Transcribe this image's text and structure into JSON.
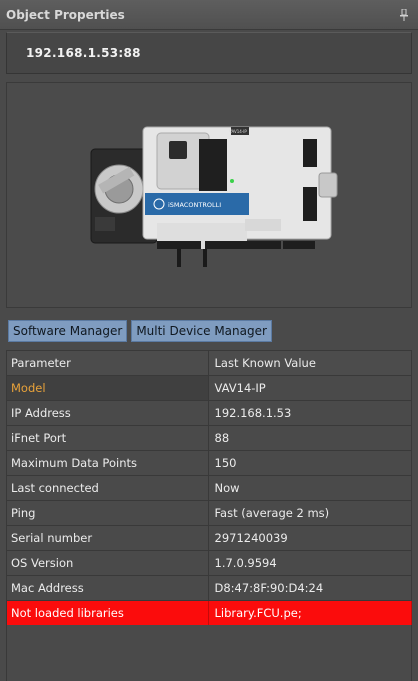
{
  "panel": {
    "title": "Object Properties",
    "pin_icon": "pin-icon"
  },
  "host": {
    "address": "192.168.1.53:88"
  },
  "device_image": {
    "brand_label": "iSMACONTROLLI",
    "model_badge": "VAV14-IP"
  },
  "buttons": {
    "software_manager": "Software Manager",
    "multi_device_manager": "Multi Device Manager"
  },
  "table": {
    "headers": {
      "parameter": "Parameter",
      "value": "Last Known Value"
    },
    "rows": [
      {
        "name": "Model",
        "value": "VAV14-IP"
      },
      {
        "name": "IP Address",
        "value": "192.168.1.53"
      },
      {
        "name": "iFnet Port",
        "value": "88"
      },
      {
        "name": "Maximum Data Points",
        "value": "150"
      },
      {
        "name": "Last connected",
        "value": "Now"
      },
      {
        "name": "Ping",
        "value": "Fast (average 2 ms)"
      },
      {
        "name": "Serial number",
        "value": "2971240039"
      },
      {
        "name": "OS Version",
        "value": "1.7.0.9594"
      },
      {
        "name": "Mac Address",
        "value": "D8:47:8F:90:D4:24"
      },
      {
        "name": "Not loaded libraries",
        "value": "Library.FCU.pe;"
      }
    ]
  },
  "colors": {
    "selected_text": "#e8a23a",
    "error_row": "#fb0c0c",
    "button_bg": "#7f9cc0"
  }
}
